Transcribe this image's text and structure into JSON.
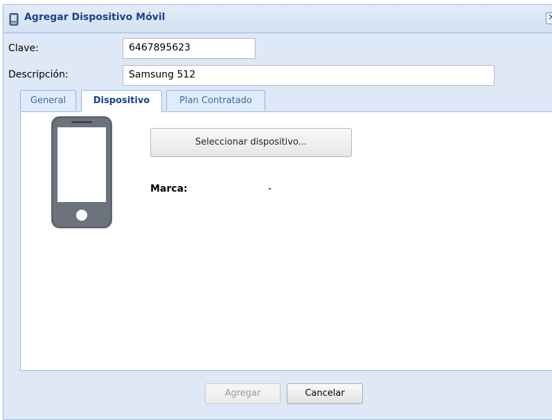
{
  "window": {
    "title": "Agregar Dispositivo Móvil",
    "close_glyph": "✕",
    "icon": "mobile-phone-icon"
  },
  "form": {
    "clave_label": "Clave:",
    "clave_value": "6467895623",
    "descripcion_label": "Descripción:",
    "descripcion_value": "Samsung 512"
  },
  "tabs": [
    {
      "label": "General",
      "active": false
    },
    {
      "label": "Dispositivo",
      "active": true
    },
    {
      "label": "Plan Contratado",
      "active": false
    }
  ],
  "device": {
    "select_button": "Seleccionar dispositivo...",
    "marca_label": "Marca:",
    "marca_value": "-",
    "image": "smartphone-icon"
  },
  "footer": {
    "agregar_label": "Agregar",
    "agregar_enabled": false,
    "cancelar_label": "Cancelar"
  },
  "colors": {
    "title_text": "#15428b",
    "window_bg": "#dfe8f6",
    "border": "#99bbe8"
  }
}
